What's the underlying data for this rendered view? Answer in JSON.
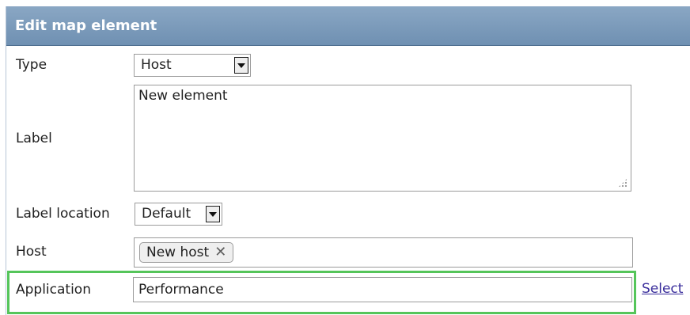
{
  "window": {
    "title": "Edit map element"
  },
  "form": {
    "type": {
      "label": "Type",
      "value": "Host"
    },
    "label": {
      "label": "Label",
      "value": "New element"
    },
    "label_location": {
      "label": "Label location",
      "value": "Default"
    },
    "host": {
      "label": "Host",
      "tag": "New host"
    },
    "application": {
      "label": "Application",
      "value": "Performance",
      "select_link": "Select"
    }
  },
  "icons": {
    "dropdown_arrow": "chevron-down-icon",
    "remove": "close-icon",
    "resize": "resize-grip-icon"
  },
  "colors": {
    "header_background": "#7f9ebd",
    "highlight_border": "#55c55a",
    "link": "#3b2f9c"
  }
}
